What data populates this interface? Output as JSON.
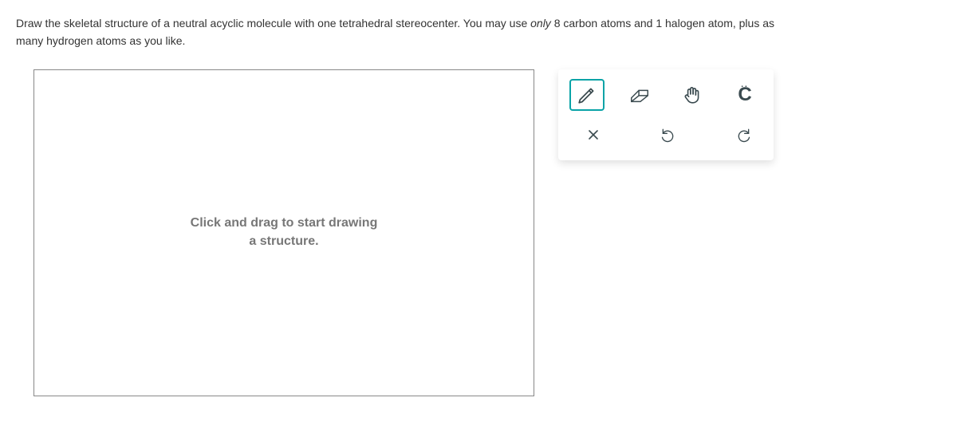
{
  "prompt": {
    "line1_prefix": "Draw the skeletal structure of a neutral acyclic molecule with one tetrahedral stereocenter. You may use ",
    "line1_italic": "only",
    "line1_mid": " 8 carbon atoms and 1 halogen atom, plus as",
    "line2": "many hydrogen atoms as you like."
  },
  "canvas": {
    "placeholder_line1": "Click and drag to start drawing",
    "placeholder_line2": "a structure."
  },
  "tools": {
    "pencil": {
      "name": "pencil-icon",
      "selected": true
    },
    "eraser": {
      "name": "eraser-icon"
    },
    "hand": {
      "name": "hand-icon"
    },
    "carbon": {
      "label": "C",
      "dots": ".."
    },
    "close": {
      "name": "close-icon"
    },
    "undo": {
      "name": "undo-icon"
    },
    "redo": {
      "name": "redo-icon"
    }
  }
}
